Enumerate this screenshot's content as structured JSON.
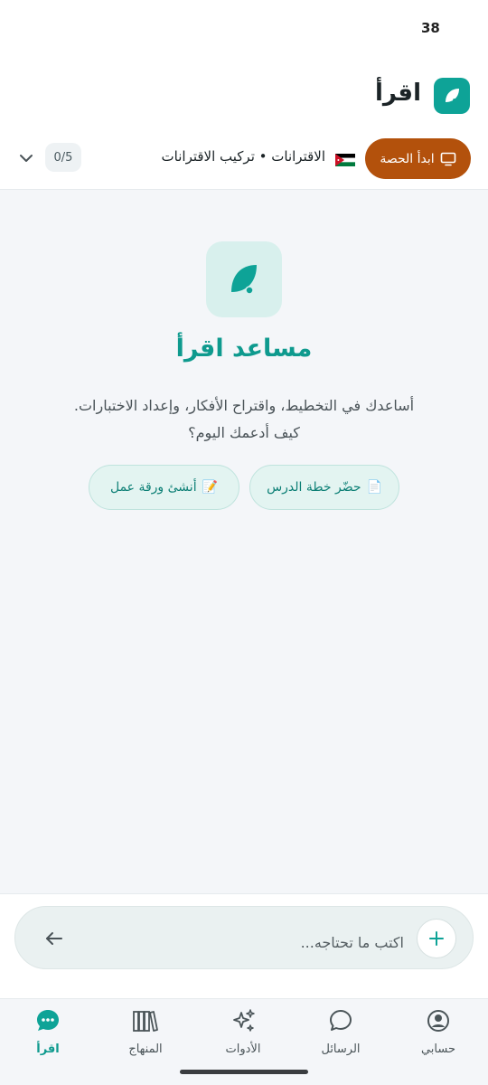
{
  "status_bar": {
    "time": "38"
  },
  "header": {
    "app_name": "اقرأ"
  },
  "lesson_bar": {
    "start_button_label": "ابدأ الحصة",
    "lesson_title": "الاقترانات • تركيب الاقترانات",
    "progress": "0/5"
  },
  "assistant": {
    "title": "مساعد اقرأ",
    "description_line1": "أساعدك في التخطيط، واقتراح الأفكار، وإعداد الاختبارات.",
    "description_line2": "كيف أدعمك اليوم؟",
    "suggestions": [
      {
        "emoji": "📄",
        "label": "حضّر خطة الدرس"
      },
      {
        "emoji": "📝",
        "label": "أنشئ ورقة عمل"
      }
    ]
  },
  "composer": {
    "placeholder": "اكتب ما تحتاجه..."
  },
  "bottom_nav": {
    "items": [
      {
        "label": "حسابي",
        "icon": "account-icon"
      },
      {
        "label": "الرسائل",
        "icon": "chat-icon"
      },
      {
        "label": "الأدوات",
        "icon": "sparkles-icon"
      },
      {
        "label": "المنهاج",
        "icon": "books-icon"
      },
      {
        "label": "اقرأ",
        "icon": "assistant-icon",
        "active": true
      }
    ]
  },
  "colors": {
    "brand_teal": "#0ea397",
    "start_button": "#b3510c",
    "background": "#f4f6f9"
  }
}
